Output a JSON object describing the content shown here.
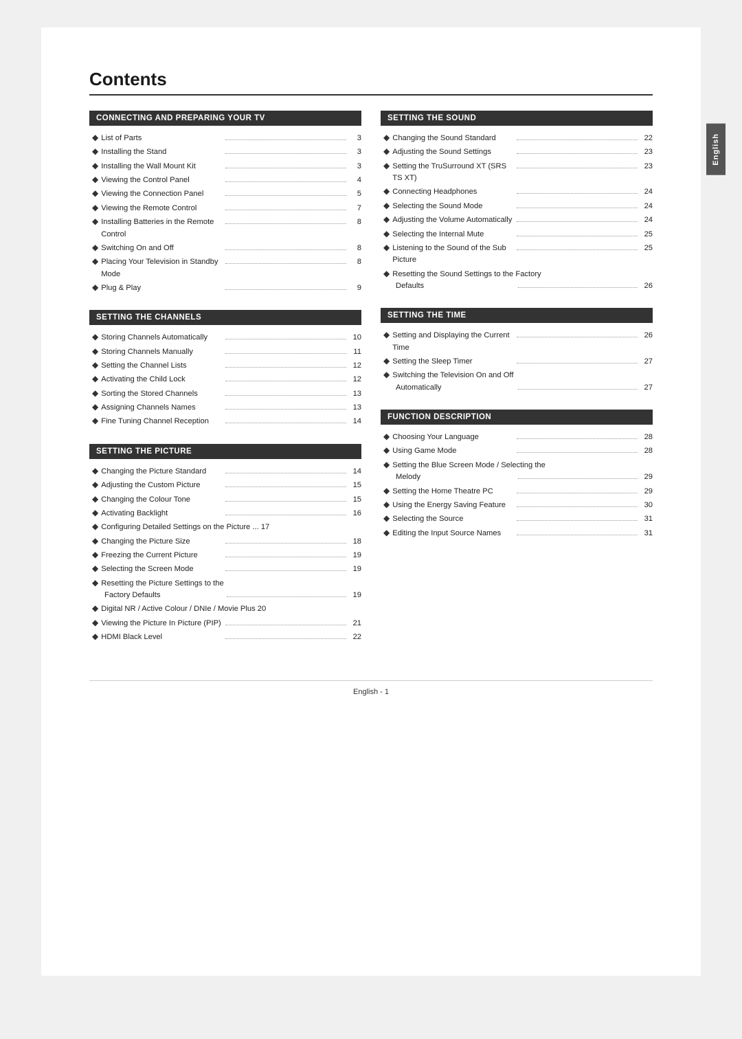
{
  "title": "Contents",
  "sidebar_label": "English",
  "footer": "English - 1",
  "sections": {
    "left": [
      {
        "id": "connecting",
        "header": "Connecting and Preparing Your TV",
        "items": [
          {
            "text": "List of Parts",
            "dots": true,
            "page": "3"
          },
          {
            "text": "Installing the Stand",
            "dots": true,
            "page": "3"
          },
          {
            "text": "Installing the Wall Mount Kit",
            "dots": true,
            "page": "3"
          },
          {
            "text": "Viewing the Control Panel",
            "dots": true,
            "page": "4"
          },
          {
            "text": "Viewing the Connection Panel",
            "dots": true,
            "page": "5"
          },
          {
            "text": "Viewing the Remote Control",
            "dots": true,
            "page": "7"
          },
          {
            "text": "Installing Batteries in the Remote Control",
            "dots": true,
            "page": "8"
          },
          {
            "text": "Switching On and Off",
            "dots": true,
            "page": "8"
          },
          {
            "text": "Placing Your Television in Standby Mode",
            "dots": true,
            "page": "8"
          },
          {
            "text": "Plug & Play",
            "dots": true,
            "page": "9"
          }
        ]
      },
      {
        "id": "channels",
        "header": "Setting the Channels",
        "items": [
          {
            "text": "Storing Channels Automatically",
            "dots": true,
            "page": "10"
          },
          {
            "text": "Storing Channels Manually",
            "dots": true,
            "page": "11"
          },
          {
            "text": "Setting the Channel Lists",
            "dots": true,
            "page": "12"
          },
          {
            "text": "Activating the Child Lock",
            "dots": true,
            "page": "12"
          },
          {
            "text": "Sorting the Stored Channels",
            "dots": true,
            "page": "13"
          },
          {
            "text": "Assigning Channels Names",
            "dots": true,
            "page": "13"
          },
          {
            "text": "Fine Tuning Channel Reception",
            "dots": true,
            "page": "14"
          }
        ]
      },
      {
        "id": "picture",
        "header": "Setting the Picture",
        "items": [
          {
            "text": "Changing the Picture Standard",
            "dots": true,
            "page": "14"
          },
          {
            "text": "Adjusting the Custom Picture",
            "dots": true,
            "page": "15"
          },
          {
            "text": "Changing the Colour Tone",
            "dots": true,
            "page": "15"
          },
          {
            "text": "Activating Backlight",
            "dots": true,
            "page": "16"
          },
          {
            "text": "Configuring Detailed Settings on the Picture",
            "dots": false,
            "page": "17",
            "prefix": "..."
          },
          {
            "text": "Changing the Picture Size",
            "dots": true,
            "page": "18"
          },
          {
            "text": "Freezing the Current Picture",
            "dots": true,
            "page": "19"
          },
          {
            "text": "Selecting the Screen Mode",
            "dots": true,
            "page": "19"
          },
          {
            "text": "Resetting the Picture Settings to the",
            "multiline": true,
            "continuation": "Factory Defaults",
            "dots": true,
            "page": "19"
          },
          {
            "text": "Digital NR / Active Colour / DNIe / Movie Plus",
            "dots": false,
            "page": "20"
          },
          {
            "text": "Viewing the Picture In Picture (PIP)",
            "dots": true,
            "page": "21"
          },
          {
            "text": "HDMI Black Level",
            "dots": true,
            "page": "22"
          }
        ]
      }
    ],
    "right": [
      {
        "id": "sound",
        "header": "Setting the Sound",
        "items": [
          {
            "text": "Changing the Sound Standard",
            "dots": true,
            "page": "22"
          },
          {
            "text": "Adjusting the Sound Settings",
            "dots": true,
            "page": "23"
          },
          {
            "text": "Setting the TruSurround XT (SRS TS XT)",
            "dots": true,
            "page": "23"
          },
          {
            "text": "Connecting Headphones",
            "dots": true,
            "page": "24"
          },
          {
            "text": "Selecting the Sound Mode",
            "dots": true,
            "page": "24"
          },
          {
            "text": "Adjusting the Volume Automatically",
            "dots": true,
            "page": "24"
          },
          {
            "text": "Selecting the Internal Mute",
            "dots": true,
            "page": "25"
          },
          {
            "text": "Listening to the Sound of the Sub Picture",
            "dots": true,
            "page": "25"
          },
          {
            "text": "Resetting the Sound Settings to the Factory",
            "multiline": true,
            "continuation": "Defaults",
            "dots": true,
            "page": "26"
          }
        ]
      },
      {
        "id": "time",
        "header": "Setting the Time",
        "items": [
          {
            "text": "Setting and Displaying the Current Time",
            "dots": true,
            "page": "26"
          },
          {
            "text": "Setting the Sleep Timer",
            "dots": true,
            "page": "27"
          },
          {
            "text": "Switching the Television On and Off",
            "multiline": true,
            "continuation": "Automatically",
            "dots": true,
            "page": "27"
          }
        ]
      },
      {
        "id": "function",
        "header": "Function Description",
        "items": [
          {
            "text": "Choosing Your Language",
            "dots": true,
            "page": "28"
          },
          {
            "text": "Using Game Mode",
            "dots": true,
            "page": "28"
          },
          {
            "text": "Setting the Blue Screen Mode / Selecting the",
            "multiline": true,
            "continuation": "Melody",
            "dots": true,
            "page": "29"
          },
          {
            "text": "Setting the Home Theatre PC",
            "dots": true,
            "page": "29"
          },
          {
            "text": "Using the Energy Saving Feature",
            "dots": true,
            "page": "30"
          },
          {
            "text": "Selecting the Source",
            "dots": true,
            "page": "31"
          },
          {
            "text": "Editing the Input Source Names",
            "dots": true,
            "page": "31"
          }
        ]
      }
    ]
  }
}
